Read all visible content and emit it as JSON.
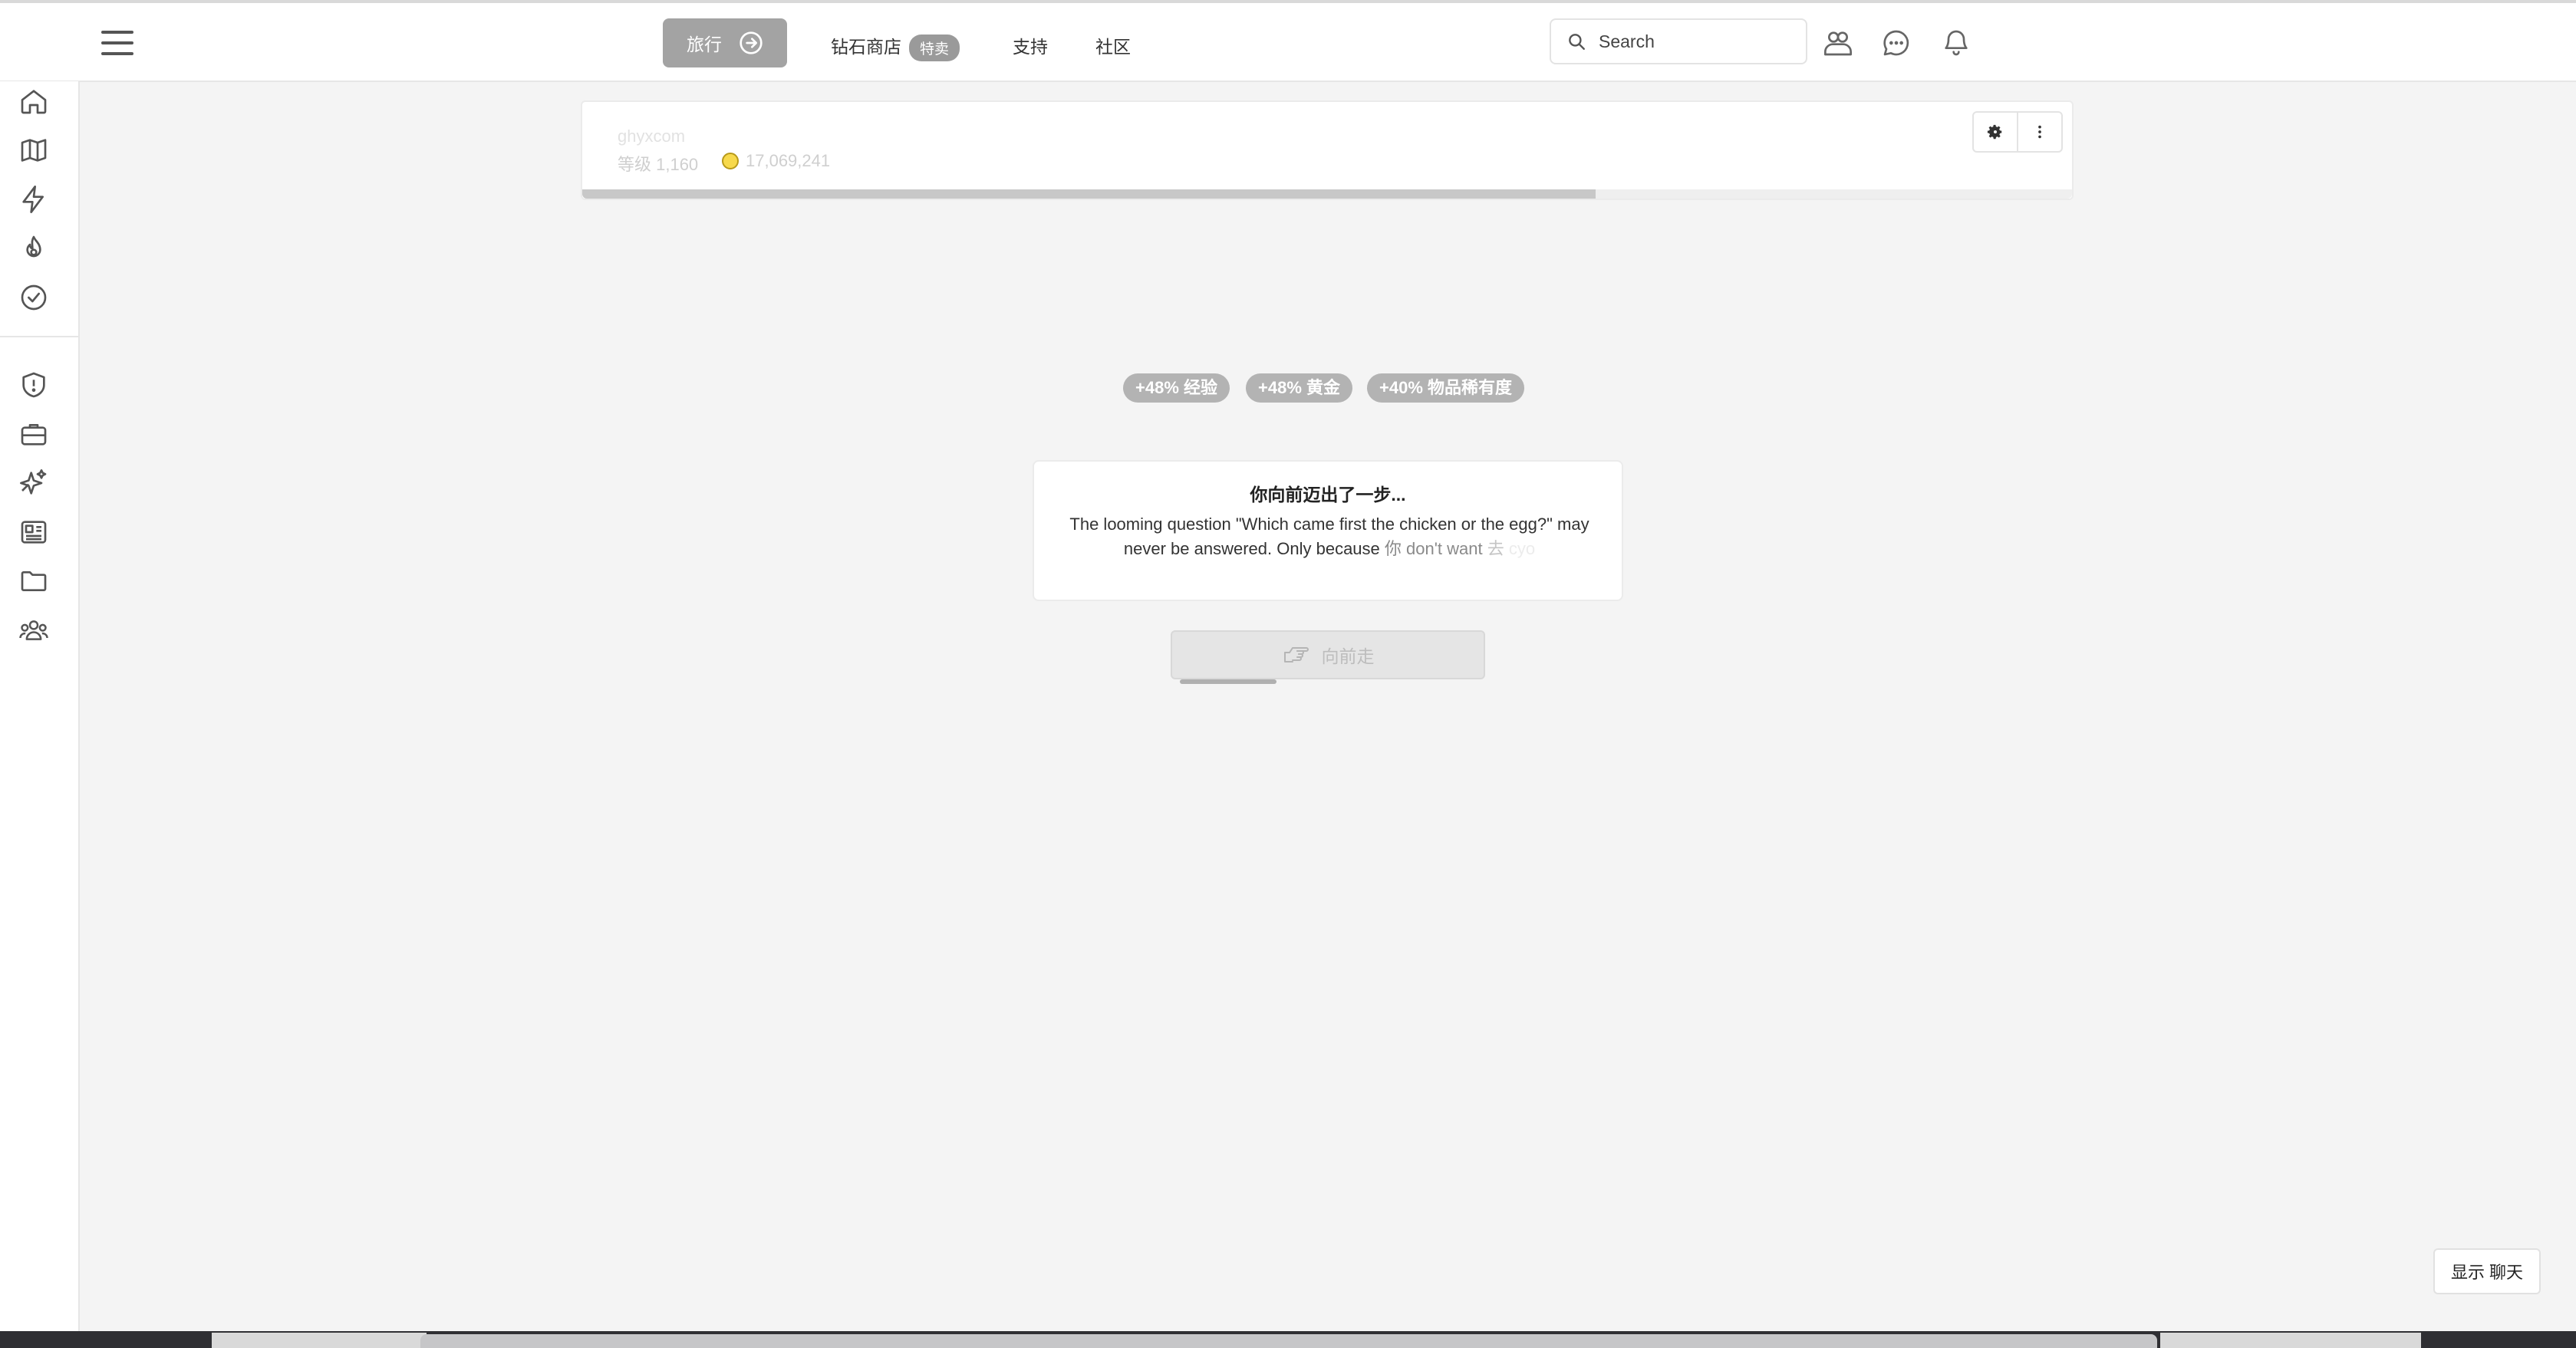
{
  "header": {
    "travel_label": "旅行",
    "nav": {
      "diamond_shop": "钻石商店",
      "sale_badge": "特卖",
      "support": "支持",
      "community": "社区"
    },
    "search_placeholder": "Search"
  },
  "sidebar": {
    "icons": [
      "home-icon",
      "map-icon",
      "lightning-icon",
      "fire-icon",
      "check-circle-icon",
      "shield-icon",
      "briefcase-icon",
      "sparkles-icon",
      "newspaper-icon",
      "folder-icon",
      "users-icon"
    ]
  },
  "player": {
    "name": "ghyxcom",
    "level": "等级 1,160",
    "gold": "17,069,241",
    "level_progress": 0.68
  },
  "bonuses": {
    "xp": "+48% 经验",
    "gold": "+48% 黄金",
    "rarity": "+40% 物品稀有度"
  },
  "step": {
    "title": "你向前迈出了一步...",
    "body_main": "The looming question \"Which came first the chicken or the egg?\" may never be answered. Only because ",
    "body_fade1": "你 don't want ",
    "body_fade2": "去",
    "body_fade3": " cyo",
    "button_label": "向前走",
    "cooldown_progress": 0.31
  },
  "chat": {
    "show_label": "显示 聊天"
  },
  "colors": {
    "travel_button": "#a3a3a3",
    "pill": "#b3b3b3",
    "coin": "#f7d94c"
  }
}
